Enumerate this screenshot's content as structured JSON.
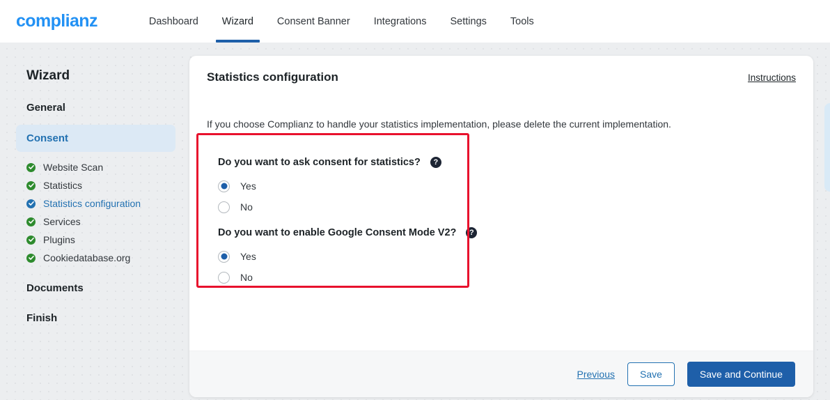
{
  "header": {
    "logo": "complianz",
    "nav": [
      {
        "label": "Dashboard",
        "active": false
      },
      {
        "label": "Wizard",
        "active": true
      },
      {
        "label": "Consent Banner",
        "active": false
      },
      {
        "label": "Integrations",
        "active": false
      },
      {
        "label": "Settings",
        "active": false
      },
      {
        "label": "Tools",
        "active": false
      }
    ]
  },
  "sidebar": {
    "title": "Wizard",
    "general_label": "General",
    "consent_label": "Consent",
    "sub_items": [
      {
        "label": "Website Scan",
        "state": "done"
      },
      {
        "label": "Statistics",
        "state": "done"
      },
      {
        "label": "Statistics configuration",
        "state": "current"
      },
      {
        "label": "Services",
        "state": "done"
      },
      {
        "label": "Plugins",
        "state": "done"
      },
      {
        "label": "Cookiedatabase.org",
        "state": "done"
      }
    ],
    "documents_label": "Documents",
    "finish_label": "Finish"
  },
  "card": {
    "title": "Statistics configuration",
    "instructions_label": "Instructions",
    "intro": "If you choose Complianz to handle your statistics implementation, please delete the current implementation.",
    "questions": [
      {
        "text": "Do you want to ask consent for statistics?",
        "help": "?",
        "options": [
          {
            "label": "Yes",
            "selected": true
          },
          {
            "label": "No",
            "selected": false
          }
        ]
      },
      {
        "text": "Do you want to enable Google Consent Mode V2?",
        "help": "?",
        "options": [
          {
            "label": "Yes",
            "selected": true
          },
          {
            "label": "No",
            "selected": false
          }
        ]
      }
    ],
    "footer": {
      "previous_label": "Previous",
      "save_label": "Save",
      "save_continue_label": "Save and Continue"
    }
  },
  "colors": {
    "brand_blue": "#2291f4",
    "accent_blue": "#1e5fa9",
    "link_blue": "#2271b1",
    "done_green": "#2e8b2e",
    "highlight_red": "#e8112d",
    "page_bg": "#eceef0"
  }
}
